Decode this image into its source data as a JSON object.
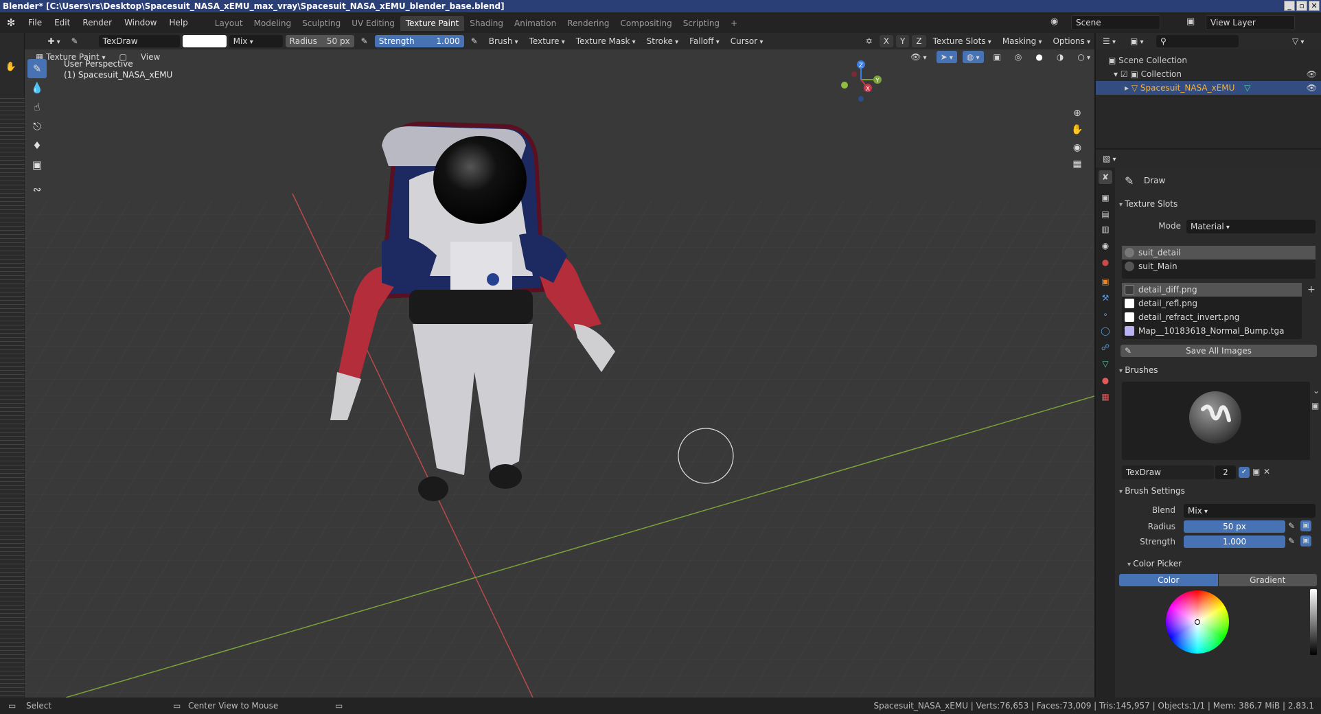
{
  "window": {
    "title": "Blender* [C:\\Users\\rs\\Desktop\\Spacesuit_NASA_xEMU_max_vray\\Spacesuit_NASA_xEMU_blender_base.blend]",
    "controls": [
      "_",
      "▫",
      "✕"
    ]
  },
  "menu": [
    "File",
    "Edit",
    "Render",
    "Window",
    "Help"
  ],
  "workspaces": [
    {
      "label": "Layout",
      "active": false
    },
    {
      "label": "Modeling",
      "active": false
    },
    {
      "label": "Sculpting",
      "active": false
    },
    {
      "label": "UV Editing",
      "active": false
    },
    {
      "label": "Texture Paint",
      "active": true
    },
    {
      "label": "Shading",
      "active": false
    },
    {
      "label": "Animation",
      "active": false
    },
    {
      "label": "Rendering",
      "active": false
    },
    {
      "label": "Compositing",
      "active": false
    },
    {
      "label": "Scripting",
      "active": false
    }
  ],
  "add_workspace": "+",
  "scene": {
    "name": "Scene",
    "view_layer": "View Layer"
  },
  "tool_header": {
    "brush_name": "TexDraw",
    "blend": "Mix",
    "radius_label": "Radius",
    "radius_value": "50 px",
    "strength_label": "Strength",
    "strength_value": "1.000",
    "menus": [
      "Brush",
      "Texture",
      "Texture Mask",
      "Stroke",
      "Falloff",
      "Cursor"
    ],
    "axes": [
      "X",
      "Y",
      "Z"
    ],
    "right_menus": [
      "Texture Slots",
      "Masking",
      "Options"
    ]
  },
  "mode_header": {
    "mode": "Texture Paint",
    "view": "View"
  },
  "viewport": {
    "perspective": "User Perspective",
    "object": "(1) Spacesuit_NASA_xEMU",
    "gizmo": {
      "z": "Z",
      "y": "Y",
      "x": "X"
    }
  },
  "outliner": {
    "root": "Scene Collection",
    "collection": "Collection",
    "object": "Spacesuit_NASA_xEMU"
  },
  "properties": {
    "tool_name": "Draw",
    "texture_slots": {
      "header": "Texture Slots",
      "mode_label": "Mode",
      "mode_value": "Material",
      "materials": [
        {
          "name": "suit_detail",
          "selected": true
        },
        {
          "name": "suit_Main",
          "selected": false
        }
      ],
      "images": [
        {
          "name": "detail_diff.png",
          "selected": true,
          "swatch": "#3a3a3a"
        },
        {
          "name": "detail_refl.png",
          "selected": false,
          "swatch": "#ffffff"
        },
        {
          "name": "detail_refract_invert.png",
          "selected": false,
          "swatch": "#ffffff"
        },
        {
          "name": "Map__10183618_Normal_Bump.tga",
          "selected": false,
          "swatch": "#b9b3f2"
        }
      ],
      "save_all": "Save All Images"
    },
    "brushes": {
      "header": "Brushes",
      "brush_name": "TexDraw",
      "users": "2"
    },
    "brush_settings": {
      "header": "Brush Settings",
      "blend_label": "Blend",
      "blend_value": "Mix",
      "radius_label": "Radius",
      "radius_value": "50 px",
      "strength_label": "Strength",
      "strength_value": "1.000"
    },
    "color_picker": {
      "header": "Color Picker",
      "tabs": [
        {
          "label": "Color",
          "active": true
        },
        {
          "label": "Gradient",
          "active": false
        }
      ]
    }
  },
  "status": {
    "left": "Select",
    "middle": "Center View to Mouse",
    "right": "Spacesuit_NASA_xEMU | Verts:76,653 | Faces:73,009 | Tris:145,957 | Objects:1/1 | Mem: 386.7 MiB | 2.83.1"
  },
  "colors": {
    "accent": "#4772b3",
    "title_bar": "#2b3f77",
    "selected_object": "#ffaf29"
  }
}
